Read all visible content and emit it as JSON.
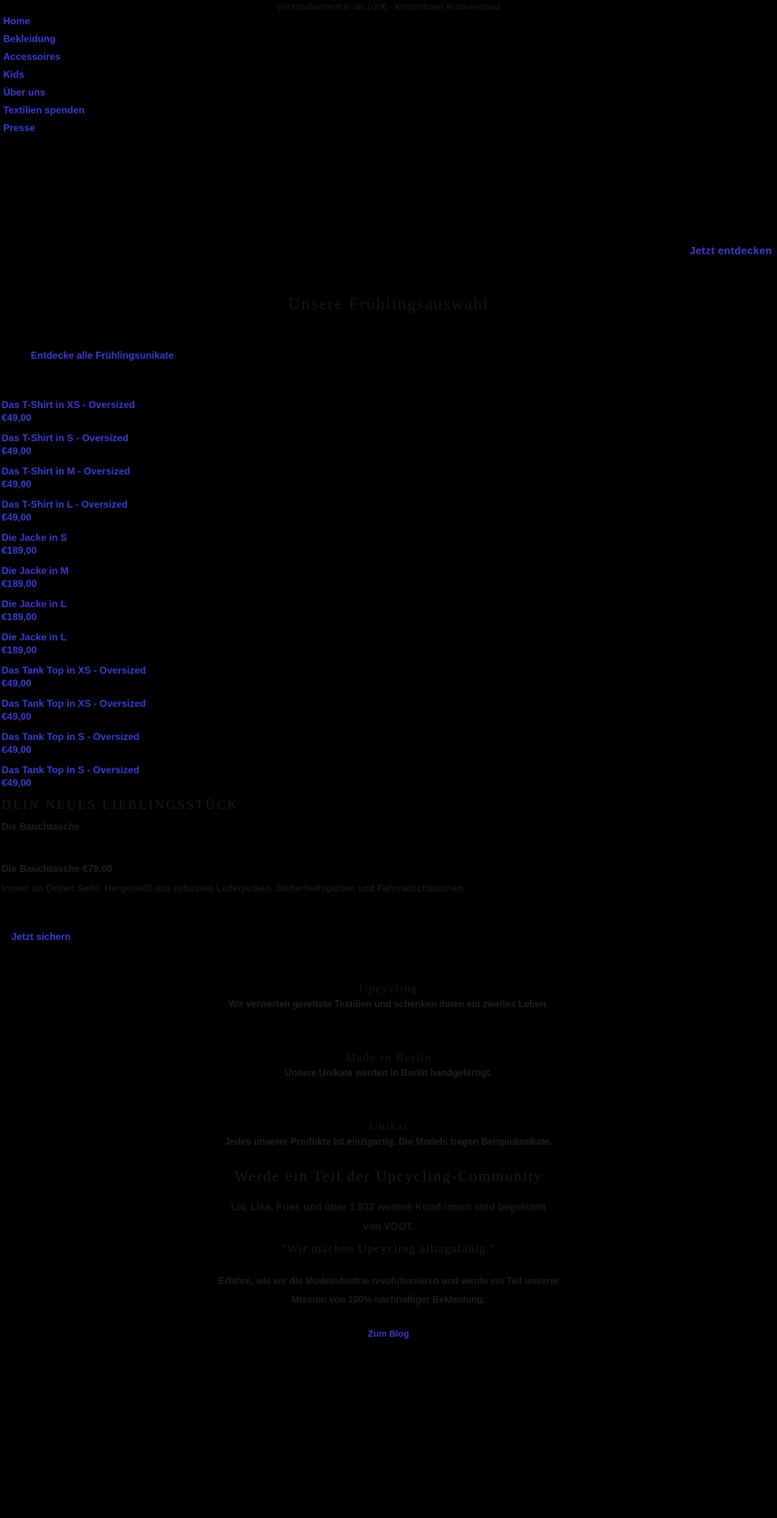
{
  "announcement": {
    "text": "Versandkostenfrei ab 100€ · Kostenloser Rückversand"
  },
  "nav": {
    "items": [
      {
        "label": "Home"
      },
      {
        "label": "Bekleidung"
      },
      {
        "label": "Accessoires"
      },
      {
        "label": "Kids"
      },
      {
        "label": "Über uns"
      },
      {
        "label": "Textilien spenden"
      },
      {
        "label": "Presse"
      }
    ]
  },
  "hero": {
    "discover_label": "Jetzt entdecken"
  },
  "spring": {
    "title": "Unsere Frühlingsauswahl",
    "discover_all_label": "Entdecke alle Frühlingsunikate"
  },
  "products": [
    {
      "name": "Das T-Shirt in XS - Oversized",
      "price": "€49,00"
    },
    {
      "name": "Das T-Shirt in S - Oversized",
      "price": "€49,00"
    },
    {
      "name": "Das T-Shirt in M - Oversized",
      "price": "€49,00"
    },
    {
      "name": "Das T-Shirt in L - Oversized",
      "price": "€49,00"
    },
    {
      "name": "Die Jacke in S",
      "price": "€189,00"
    },
    {
      "name": "Die Jacke in M",
      "price": "€189,00"
    },
    {
      "name": "Die Jacke in L",
      "price": "€189,00"
    },
    {
      "name": "Die Jacke in L",
      "price": "€189,00"
    },
    {
      "name": "Das Tank Top in XS - Oversized",
      "price": "€49,00"
    },
    {
      "name": "Das Tank Top in XS - Oversized",
      "price": "€49,00"
    },
    {
      "name": "Das Tank Top in S - Oversized",
      "price": "€49,00"
    },
    {
      "name": "Das Tank Top in S - Oversized",
      "price": "€49,00"
    }
  ],
  "feature": {
    "heading": "DEIN NEUES LIEBLINGSSTÜCK",
    "product_link": "Die Bauchtasche",
    "product_line": "Die Bauchtasche  €79,00",
    "description": "Immer an Deiner Seite. Hergestellt aus robusten Lederjacken, Sicherheitsgurten und Fahrradschläuchen.",
    "secure_label": "Jetzt sichern"
  },
  "values": [
    {
      "title": "Upcycling",
      "body": "Wir verwerten gerettete Textilien und schenken ihnen ein zweites Leben."
    },
    {
      "title": "Made in Berlin",
      "body": "Unsere Unikate werden in Berlin handgefertigt."
    },
    {
      "title": "Unikat",
      "body": "Jedes unserer Produkte ist einzigartig. Die Models tragen Beispielunikate."
    }
  ],
  "community": {
    "title": "Werde ein Teil der Upcycling-Community",
    "subtitle_line1": "Liv, Lisa, Fries und über 1.932 weitere Kund:innen sind begeistert",
    "subtitle_line2": "von VOOT.",
    "quote": "\"Wir machen Upcycling alltagsfähig.\"",
    "mission_line1": "Erfahre, wie wir die Modeindustrie revolutionieren und werde ein Teil unserer",
    "mission_line2": "Mission von 100% nachhaltiger Bekleidung.",
    "blog_label": "Zum Blog"
  },
  "colors": {
    "background": "#000000",
    "link": "#3b3bd4",
    "muted_text": "#1a1a1a"
  }
}
